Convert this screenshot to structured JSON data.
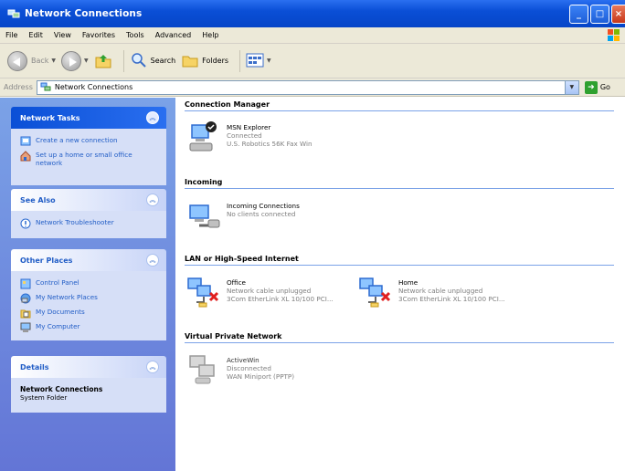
{
  "window": {
    "title": "Network Connections"
  },
  "menu": [
    "File",
    "Edit",
    "View",
    "Favorites",
    "Tools",
    "Advanced",
    "Help"
  ],
  "toolbar": {
    "back_label": "Back",
    "search_label": "Search",
    "folders_label": "Folders"
  },
  "address": {
    "label": "Address",
    "value": "Network Connections",
    "go_label": "Go"
  },
  "left": {
    "network_tasks": {
      "title": "Network Tasks",
      "items": [
        "Create a new connection",
        "Set up a home or small office network"
      ]
    },
    "see_also": {
      "title": "See Also",
      "items": [
        "Network Troubleshooter"
      ]
    },
    "other_places": {
      "title": "Other Places",
      "items": [
        "Control Panel",
        "My Network Places",
        "My Documents",
        "My Computer"
      ]
    },
    "details": {
      "title": "Details",
      "name": "Network Connections",
      "type": "System Folder"
    }
  },
  "groups": [
    {
      "title": "Connection Manager",
      "items": [
        {
          "name": "MSN Explorer",
          "status": "Connected",
          "device": "U.S. Robotics 56K Fax Win"
        }
      ]
    },
    {
      "title": "Incoming",
      "items": [
        {
          "name": "Incoming Connections",
          "status": "No clients connected"
        }
      ]
    },
    {
      "title": "LAN or High-Speed Internet",
      "items": [
        {
          "name": "Office",
          "status": "Network cable unplugged",
          "device": "3Com EtherLink XL 10/100 PCI..."
        },
        {
          "name": "Home",
          "status": "Network cable unplugged",
          "device": "3Com EtherLink XL 10/100 PCI..."
        }
      ]
    },
    {
      "title": "Virtual Private Network",
      "items": [
        {
          "name": "ActiveWin",
          "status": "Disconnected",
          "device": "WAN Miniport (PPTP)"
        }
      ]
    }
  ],
  "colors": {
    "title_bar": "#0a4fd6",
    "left_pane": "#6b8be0",
    "task_link": "#215dc6",
    "group_rule": "#7ba2e7"
  }
}
